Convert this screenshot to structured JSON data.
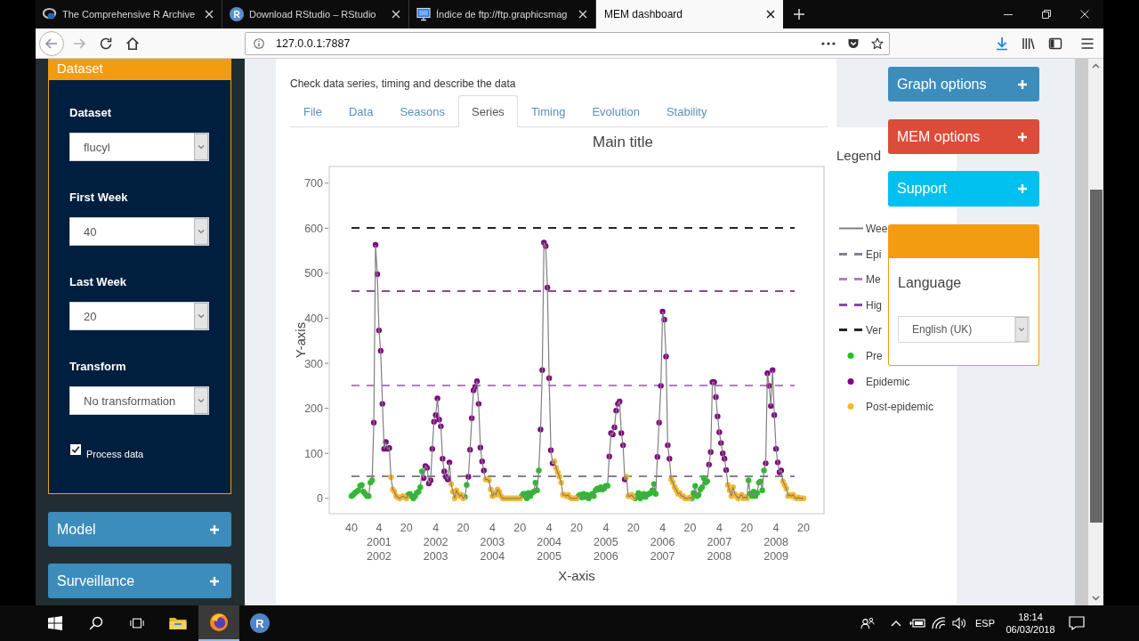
{
  "browser": {
    "tabs": [
      {
        "title": "The Comprehensive R Archive",
        "kind": "ring",
        "selected": false
      },
      {
        "title": "Download RStudio – RStudio",
        "kind": "letter",
        "icon_letter": "R",
        "selected": false
      },
      {
        "title": "Índice de ftp://ftp.graphicsmag",
        "kind": "monitor",
        "selected": false
      },
      {
        "title": "MEM dashboard",
        "kind": "plain",
        "selected": true
      }
    ],
    "address": "127.0.0.1:7887"
  },
  "sidebar": {
    "dataset_box": {
      "title": "Dataset",
      "fields": [
        {
          "label": "Dataset",
          "value": "flucyl"
        },
        {
          "label": "First Week",
          "value": "40"
        },
        {
          "label": "Last Week",
          "value": "20"
        },
        {
          "label": "Transform",
          "value": "No transformation"
        }
      ],
      "checkbox": {
        "label": "Process data",
        "checked": true
      }
    },
    "boxes": [
      {
        "title": "Model"
      },
      {
        "title": "Surveillance"
      }
    ]
  },
  "main": {
    "description": "Check data series, timing and describe the data",
    "tabs": [
      {
        "label": "File",
        "selected": false
      },
      {
        "label": "Data",
        "selected": false
      },
      {
        "label": "Seasons",
        "selected": false
      },
      {
        "label": "Series",
        "selected": true
      },
      {
        "label": "Timing",
        "selected": false
      },
      {
        "label": "Evolution",
        "selected": false
      },
      {
        "label": "Stability",
        "selected": false
      }
    ],
    "chart_data": {
      "type": "line",
      "title": "Main title",
      "xlabel": "X-axis",
      "ylabel": "Y-axis",
      "legend_title": "Legend",
      "legend": "right",
      "categories": [
        "40",
        null,
        null,
        null,
        null,
        null,
        null,
        null,
        null,
        null,
        null,
        null,
        null,
        null,
        null,
        null,
        "4\n2001\n2002",
        null,
        null,
        null,
        null,
        null,
        null,
        null,
        null,
        null,
        null,
        null,
        null,
        null,
        null,
        null,
        "20",
        null,
        null,
        null,
        null,
        null,
        null,
        null,
        null,
        null,
        null,
        null,
        null,
        null,
        null,
        null,
        null,
        "4\n2002\n2003",
        null,
        null,
        null,
        null,
        null,
        null,
        null,
        null,
        null,
        null,
        null,
        null,
        null,
        null,
        null,
        "20",
        null,
        null,
        null,
        null,
        null,
        null,
        null,
        null,
        null,
        null,
        null,
        null,
        null,
        null,
        null,
        null,
        "4\n2003\n2004",
        null,
        null,
        null,
        null,
        null,
        null,
        null,
        null,
        null,
        null,
        null,
        null,
        null,
        null,
        null,
        "20",
        null,
        null,
        null,
        null,
        null,
        null,
        null,
        null,
        null,
        null,
        null,
        null,
        null,
        null,
        null,
        null,
        "4\n2004\n2005",
        null,
        null,
        null,
        null,
        null,
        null,
        null,
        null,
        null,
        null,
        null,
        null,
        null,
        null,
        null,
        "20",
        null,
        null,
        null,
        null,
        null,
        null,
        null,
        null,
        null,
        null,
        null,
        null,
        null,
        null,
        null,
        null,
        "4\n2005\n2006",
        null,
        null,
        null,
        null,
        null,
        null,
        null,
        null,
        null,
        null,
        null,
        null,
        null,
        null,
        null,
        "20",
        null,
        null,
        null,
        null,
        null,
        null,
        null,
        null,
        null,
        null,
        null,
        null,
        null,
        null,
        null,
        null,
        "4\n2006\n2007",
        null,
        null,
        null,
        null,
        null,
        null,
        null,
        null,
        null,
        null,
        null,
        null,
        null,
        null,
        null,
        "20",
        null,
        null,
        null,
        null,
        null,
        null,
        null,
        null,
        null,
        null,
        null,
        null,
        null,
        null,
        null,
        null,
        "4\n2007\n2008",
        null,
        null,
        null,
        null,
        null,
        null,
        null,
        null,
        null,
        null,
        null,
        null,
        null,
        null,
        null,
        "20",
        null,
        null,
        null,
        null,
        null,
        null,
        null,
        null,
        null,
        null,
        null,
        null,
        null,
        null,
        null,
        null,
        "4\n2008\n2009",
        null,
        null,
        null,
        null,
        null,
        null,
        null,
        null,
        null,
        null,
        null,
        null,
        null,
        null,
        null,
        "20"
      ],
      "ylim": [
        -34,
        737
      ],
      "yticks": [
        0,
        100,
        200,
        300,
        400,
        500,
        600,
        700
      ],
      "series": [
        {
          "name": "Wee",
          "type": "line",
          "color": "#808080",
          "values": [
            5,
            8,
            12,
            15,
            18,
            28,
            30,
            15,
            10,
            5,
            5,
            35,
            40,
            168,
            563,
            498,
            373,
            328,
            210,
            110,
            125,
            110,
            112,
            47,
            20,
            15,
            5,
            2,
            0,
            3,
            5,
            2,
            0,
            8,
            10,
            5,
            0,
            5,
            12,
            15,
            25,
            60,
            45,
            72,
            68,
            33,
            40,
            110,
            170,
            185,
            222,
            175,
            160,
            88,
            60,
            48,
            42,
            80,
            32,
            15,
            0,
            18,
            10,
            5,
            8,
            0,
            3,
            30,
            48,
            108,
            178,
            240,
            248,
            260,
            210,
            113,
            82,
            62,
            42,
            42,
            40,
            20,
            5,
            12,
            8,
            20,
            15,
            5,
            0,
            0,
            0,
            0,
            0,
            0,
            0,
            0,
            0,
            0,
            0,
            5,
            10,
            10,
            0,
            12,
            5,
            12,
            15,
            35,
            18,
            62,
            153,
            285,
            568,
            560,
            468,
            267,
            107,
            78,
            82,
            68,
            58,
            48,
            35,
            8,
            8,
            5,
            8,
            2,
            0,
            0,
            0,
            0,
            5,
            8,
            2,
            10,
            3,
            8,
            0,
            5,
            10,
            5,
            18,
            22,
            20,
            25,
            20,
            22,
            28,
            28,
            93,
            145,
            142,
            158,
            195,
            210,
            215,
            145,
            118,
            42,
            48,
            5,
            5,
            8,
            2,
            0,
            5,
            12,
            0,
            5,
            10,
            3,
            8,
            10,
            12,
            18,
            32,
            10,
            92,
            168,
            250,
            415,
            397,
            315,
            118,
            88,
            42,
            35,
            25,
            18,
            10,
            12,
            5,
            5,
            0,
            0,
            0,
            2,
            0,
            12,
            28,
            5,
            8,
            20,
            25,
            45,
            35,
            38,
            75,
            103,
            258,
            258,
            225,
            182,
            147,
            123,
            100,
            88,
            63,
            30,
            18,
            5,
            25,
            10,
            5,
            0,
            5,
            8,
            0,
            3,
            0,
            40,
            10,
            5,
            15,
            5,
            12,
            35,
            38,
            18,
            62,
            78,
            278,
            250,
            205,
            285,
            185,
            110,
            80,
            58,
            62,
            38,
            30,
            22,
            5,
            8,
            5,
            8,
            2,
            0,
            2,
            0,
            0,
            0
          ]
        },
        {
          "name": "Pre",
          "type": "scatter",
          "color": "#22c322",
          "values": [
            5,
            8,
            12,
            15,
            18,
            28,
            30,
            15,
            10,
            5,
            5,
            35,
            40,
            null,
            null,
            null,
            null,
            null,
            null,
            null,
            null,
            null,
            null,
            null,
            null,
            null,
            null,
            null,
            null,
            null,
            null,
            null,
            null,
            8,
            10,
            5,
            0,
            5,
            12,
            15,
            25,
            60,
            null,
            null,
            null,
            null,
            null,
            null,
            null,
            null,
            null,
            null,
            null,
            null,
            null,
            null,
            null,
            null,
            null,
            null,
            null,
            null,
            null,
            null,
            null,
            null,
            3,
            30,
            null,
            null,
            null,
            null,
            null,
            null,
            null,
            null,
            null,
            null,
            null,
            null,
            null,
            null,
            null,
            null,
            null,
            null,
            null,
            null,
            null,
            null,
            null,
            null,
            null,
            null,
            null,
            null,
            null,
            null,
            null,
            5,
            10,
            10,
            0,
            12,
            5,
            12,
            15,
            35,
            18,
            62,
            null,
            null,
            null,
            null,
            null,
            null,
            null,
            null,
            null,
            null,
            null,
            null,
            null,
            null,
            null,
            null,
            null,
            null,
            null,
            null,
            null,
            null,
            5,
            8,
            2,
            10,
            3,
            8,
            0,
            5,
            10,
            5,
            18,
            22,
            20,
            25,
            20,
            22,
            28,
            28,
            null,
            null,
            null,
            null,
            null,
            null,
            null,
            null,
            null,
            null,
            null,
            null,
            null,
            null,
            null,
            0,
            5,
            12,
            0,
            5,
            10,
            3,
            8,
            10,
            12,
            18,
            32,
            10,
            null,
            null,
            null,
            null,
            null,
            null,
            null,
            null,
            null,
            null,
            null,
            null,
            null,
            null,
            null,
            null,
            null,
            null,
            null,
            null,
            0,
            12,
            28,
            5,
            8,
            20,
            25,
            45,
            35,
            38,
            null,
            null,
            null,
            null,
            null,
            null,
            null,
            null,
            null,
            null,
            null,
            null,
            null,
            null,
            null,
            null,
            null,
            null,
            null,
            null,
            null,
            null,
            null,
            40,
            10,
            5,
            15,
            5,
            12,
            35,
            38,
            18,
            62,
            null,
            null,
            null,
            null,
            null,
            null,
            null,
            null,
            null,
            null,
            null,
            null,
            null,
            null,
            null,
            null,
            null,
            null,
            null,
            null,
            null,
            null,
            null
          ]
        },
        {
          "name": "Epidemic",
          "type": "scatter",
          "color": "#800080",
          "values": [
            null,
            null,
            null,
            null,
            null,
            null,
            null,
            null,
            null,
            null,
            null,
            null,
            null,
            168,
            563,
            498,
            373,
            328,
            210,
            110,
            125,
            110,
            112,
            null,
            null,
            null,
            null,
            null,
            null,
            null,
            null,
            null,
            null,
            null,
            null,
            null,
            null,
            null,
            null,
            null,
            null,
            null,
            45,
            72,
            68,
            33,
            40,
            110,
            170,
            185,
            222,
            175,
            160,
            88,
            60,
            48,
            42,
            80,
            null,
            null,
            null,
            null,
            null,
            null,
            null,
            null,
            null,
            null,
            48,
            108,
            178,
            240,
            248,
            260,
            210,
            113,
            82,
            62,
            null,
            null,
            null,
            null,
            null,
            null,
            null,
            null,
            null,
            null,
            null,
            null,
            null,
            null,
            null,
            null,
            null,
            null,
            null,
            null,
            null,
            null,
            null,
            null,
            null,
            null,
            null,
            null,
            null,
            null,
            null,
            null,
            153,
            285,
            568,
            560,
            468,
            267,
            107,
            78,
            null,
            null,
            null,
            null,
            null,
            null,
            null,
            null,
            null,
            null,
            null,
            null,
            null,
            null,
            null,
            null,
            null,
            null,
            null,
            null,
            null,
            null,
            null,
            null,
            null,
            null,
            null,
            null,
            null,
            null,
            null,
            null,
            93,
            145,
            142,
            158,
            195,
            210,
            215,
            145,
            118,
            42,
            null,
            null,
            null,
            null,
            null,
            null,
            null,
            null,
            null,
            null,
            null,
            null,
            null,
            null,
            null,
            null,
            null,
            null,
            92,
            168,
            250,
            415,
            397,
            315,
            118,
            88,
            null,
            null,
            null,
            null,
            null,
            null,
            null,
            null,
            null,
            null,
            null,
            null,
            null,
            null,
            null,
            null,
            null,
            null,
            null,
            null,
            null,
            null,
            75,
            103,
            258,
            258,
            225,
            182,
            147,
            123,
            100,
            88,
            63,
            null,
            null,
            null,
            null,
            null,
            null,
            null,
            null,
            null,
            null,
            null,
            null,
            null,
            null,
            null,
            null,
            null,
            null,
            null,
            null,
            null,
            null,
            78,
            278,
            250,
            205,
            285,
            185,
            110,
            80,
            58,
            62,
            null,
            null,
            null,
            null,
            null,
            null,
            null,
            null,
            null,
            null,
            null,
            null,
            null
          ]
        },
        {
          "name": "Post-epidemic",
          "type": "scatter",
          "color": "#f9b92b",
          "values": [
            null,
            null,
            null,
            null,
            null,
            null,
            null,
            null,
            null,
            null,
            null,
            null,
            null,
            null,
            null,
            null,
            null,
            null,
            null,
            null,
            null,
            null,
            null,
            47,
            20,
            15,
            5,
            2,
            0,
            3,
            5,
            2,
            0,
            null,
            null,
            null,
            null,
            null,
            null,
            null,
            null,
            null,
            null,
            null,
            null,
            null,
            null,
            null,
            null,
            null,
            null,
            null,
            null,
            null,
            null,
            null,
            null,
            null,
            32,
            15,
            0,
            18,
            10,
            5,
            8,
            0,
            null,
            null,
            null,
            null,
            null,
            null,
            null,
            null,
            null,
            null,
            null,
            null,
            42,
            42,
            40,
            20,
            5,
            12,
            8,
            20,
            15,
            5,
            0,
            0,
            0,
            0,
            0,
            0,
            0,
            0,
            0,
            0,
            0,
            null,
            null,
            null,
            null,
            null,
            null,
            null,
            null,
            null,
            null,
            null,
            null,
            null,
            null,
            null,
            null,
            null,
            null,
            null,
            82,
            68,
            58,
            48,
            35,
            8,
            8,
            5,
            8,
            2,
            0,
            0,
            0,
            0,
            null,
            null,
            null,
            null,
            null,
            null,
            null,
            null,
            null,
            null,
            null,
            null,
            null,
            null,
            null,
            null,
            null,
            null,
            null,
            null,
            null,
            null,
            null,
            null,
            null,
            null,
            null,
            null,
            48,
            5,
            5,
            8,
            2,
            null,
            null,
            null,
            null,
            null,
            null,
            null,
            null,
            null,
            null,
            null,
            null,
            null,
            null,
            null,
            null,
            null,
            null,
            null,
            null,
            null,
            42,
            35,
            25,
            18,
            10,
            12,
            5,
            5,
            0,
            0,
            0,
            2,
            null,
            null,
            null,
            null,
            null,
            null,
            null,
            null,
            null,
            null,
            null,
            null,
            null,
            null,
            null,
            null,
            null,
            null,
            null,
            null,
            null,
            30,
            18,
            5,
            25,
            10,
            5,
            0,
            5,
            8,
            0,
            3,
            0,
            null,
            null,
            null,
            null,
            null,
            null,
            null,
            null,
            null,
            null,
            null,
            null,
            null,
            null,
            null,
            null,
            null,
            null,
            null,
            null,
            38,
            30,
            22,
            5,
            8,
            5,
            8,
            2,
            0,
            2,
            0,
            0,
            0
          ]
        }
      ],
      "ref_lines": [
        {
          "axis": "y",
          "value": 50,
          "label": "Epi",
          "color": "#858090",
          "line_style": "dash"
        },
        {
          "axis": "y",
          "value": 250,
          "label": "Me",
          "color": "#b27cc6",
          "line_style": "dash"
        },
        {
          "axis": "y",
          "value": 460,
          "label": "Hig",
          "color": "#8e44a0",
          "line_style": "dash"
        },
        {
          "axis": "y",
          "value": 600,
          "label": "Ver",
          "color": "#2b1f2e",
          "line_style": "dash"
        }
      ]
    }
  },
  "right_panel": {
    "boxes": [
      {
        "title": "Graph options",
        "color": "#3c8dbc"
      },
      {
        "title": "MEM options",
        "color": "#dd4b39"
      },
      {
        "title": "Support",
        "color": "#00c0ef"
      }
    ],
    "language_box": {
      "label": "Language",
      "value": "English (UK)"
    }
  },
  "taskbar": {
    "apps": [
      {
        "kind": "folder",
        "selected": false
      },
      {
        "kind": "fox",
        "selected": true
      },
      {
        "kind": "letter",
        "icon_letter": "R",
        "selected": false
      }
    ],
    "input_language": "ESP",
    "time": "18:14",
    "date": "06/03/2018"
  }
}
